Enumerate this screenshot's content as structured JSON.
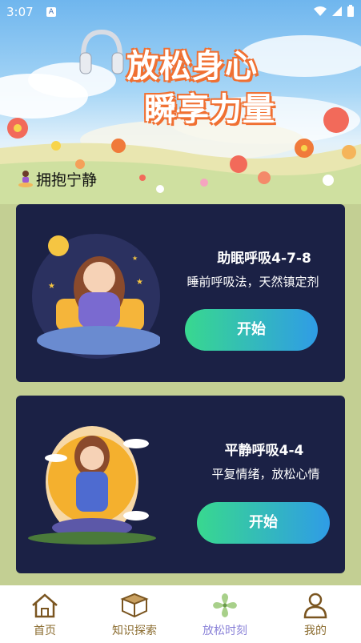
{
  "status_bar": {
    "time": "3:07",
    "app_indicator": "A"
  },
  "hero": {
    "title_line1": "放松身心",
    "title_line2": "瞬享力量",
    "section_label": "拥抱宁静"
  },
  "cards": [
    {
      "title": "助眠呼吸4-7-8",
      "subtitle": "睡前呼吸法，天然镇定剂",
      "button": "开始"
    },
    {
      "title": "平静呼吸4-4",
      "subtitle": "平复情绪，放松心情",
      "button": "开始"
    }
  ],
  "tabbar": {
    "tabs": [
      {
        "label": "首页",
        "icon": "home-icon"
      },
      {
        "label": "知识探索",
        "icon": "book-icon"
      },
      {
        "label": "放松时刻",
        "icon": "pinwheel-icon",
        "active": true
      },
      {
        "label": "我的",
        "icon": "profile-icon"
      }
    ]
  },
  "colors": {
    "card_bg": "#1b2145",
    "button_start": "#38d88f",
    "button_end": "#2f9ce6",
    "title_outline": "#f07032",
    "tab_text": "#8a6b2e",
    "tab_active": "#8a82d8",
    "page_bg": "#c3cf93"
  }
}
